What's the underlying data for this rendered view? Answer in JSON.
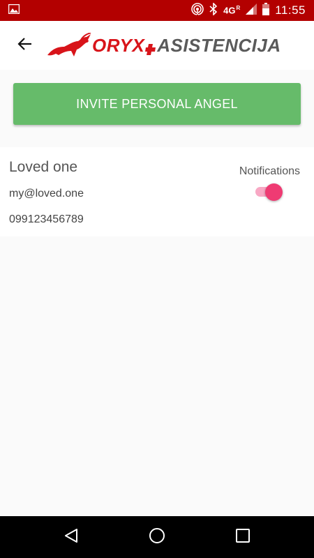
{
  "status_bar": {
    "time": "11:55",
    "network": "4G",
    "roaming": "R",
    "icons": [
      "image-icon",
      "hotspot-icon",
      "bluetooth-icon",
      "signal-icon",
      "battery-icon"
    ]
  },
  "app_bar": {
    "logo_primary": "ORYX",
    "logo_secondary": "ASISTENCIJA",
    "brand_red": "#d8141a",
    "brand_grey": "#5a5a5a"
  },
  "invite_button": {
    "label": "INVITE PERSONAL ANGEL",
    "color": "#66bb6a"
  },
  "contacts": [
    {
      "name": "Loved one",
      "email": "my@loved.one",
      "phone": "099123456789",
      "notifications_label": "Notifications",
      "notifications_on": true,
      "toggle_color": "#ef3b73"
    }
  ],
  "nav_bar": {
    "icons": [
      "back-triangle-icon",
      "home-circle-icon",
      "recents-square-icon"
    ]
  }
}
